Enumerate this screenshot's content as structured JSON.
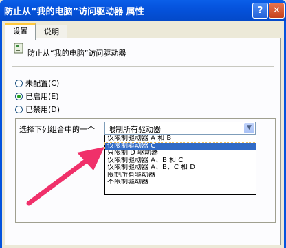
{
  "window": {
    "title": "防止从“我的电脑”访问驱动器 属性",
    "help_glyph": "?",
    "close_glyph": "✕"
  },
  "tabs": [
    {
      "label": "设置",
      "active": true
    },
    {
      "label": "说明",
      "active": false
    }
  ],
  "policy": {
    "icon": "policy-setting-icon",
    "name": "防止从“我的电脑”访问驱动器"
  },
  "radios": [
    {
      "label": "未配置(C)",
      "checked": false
    },
    {
      "label": "已启用(E)",
      "checked": true
    },
    {
      "label": "已禁用(D)",
      "checked": false
    }
  ],
  "options": {
    "prompt": "选择下列组合中的一个",
    "selected_value": "限制所有驱动器",
    "dropdown_items": [
      {
        "label": "仅限制驱动器 A 和 B",
        "highlighted": false
      },
      {
        "label": "仅限制驱动器 C",
        "highlighted": true
      },
      {
        "label": "只限制 D 驱动器",
        "highlighted": false
      },
      {
        "label": "仅限制驱动器 A、B 和 C",
        "highlighted": false
      },
      {
        "label": "仅限制驱动器 A、B、C 和 D",
        "highlighted": false
      },
      {
        "label": "限制所有驱动器",
        "highlighted": false
      },
      {
        "label": "不限制驱动器",
        "highlighted": false
      }
    ]
  },
  "colors": {
    "title_bar": "#0553dd",
    "selection": "#316ac5",
    "arrow": "#f0306a"
  }
}
